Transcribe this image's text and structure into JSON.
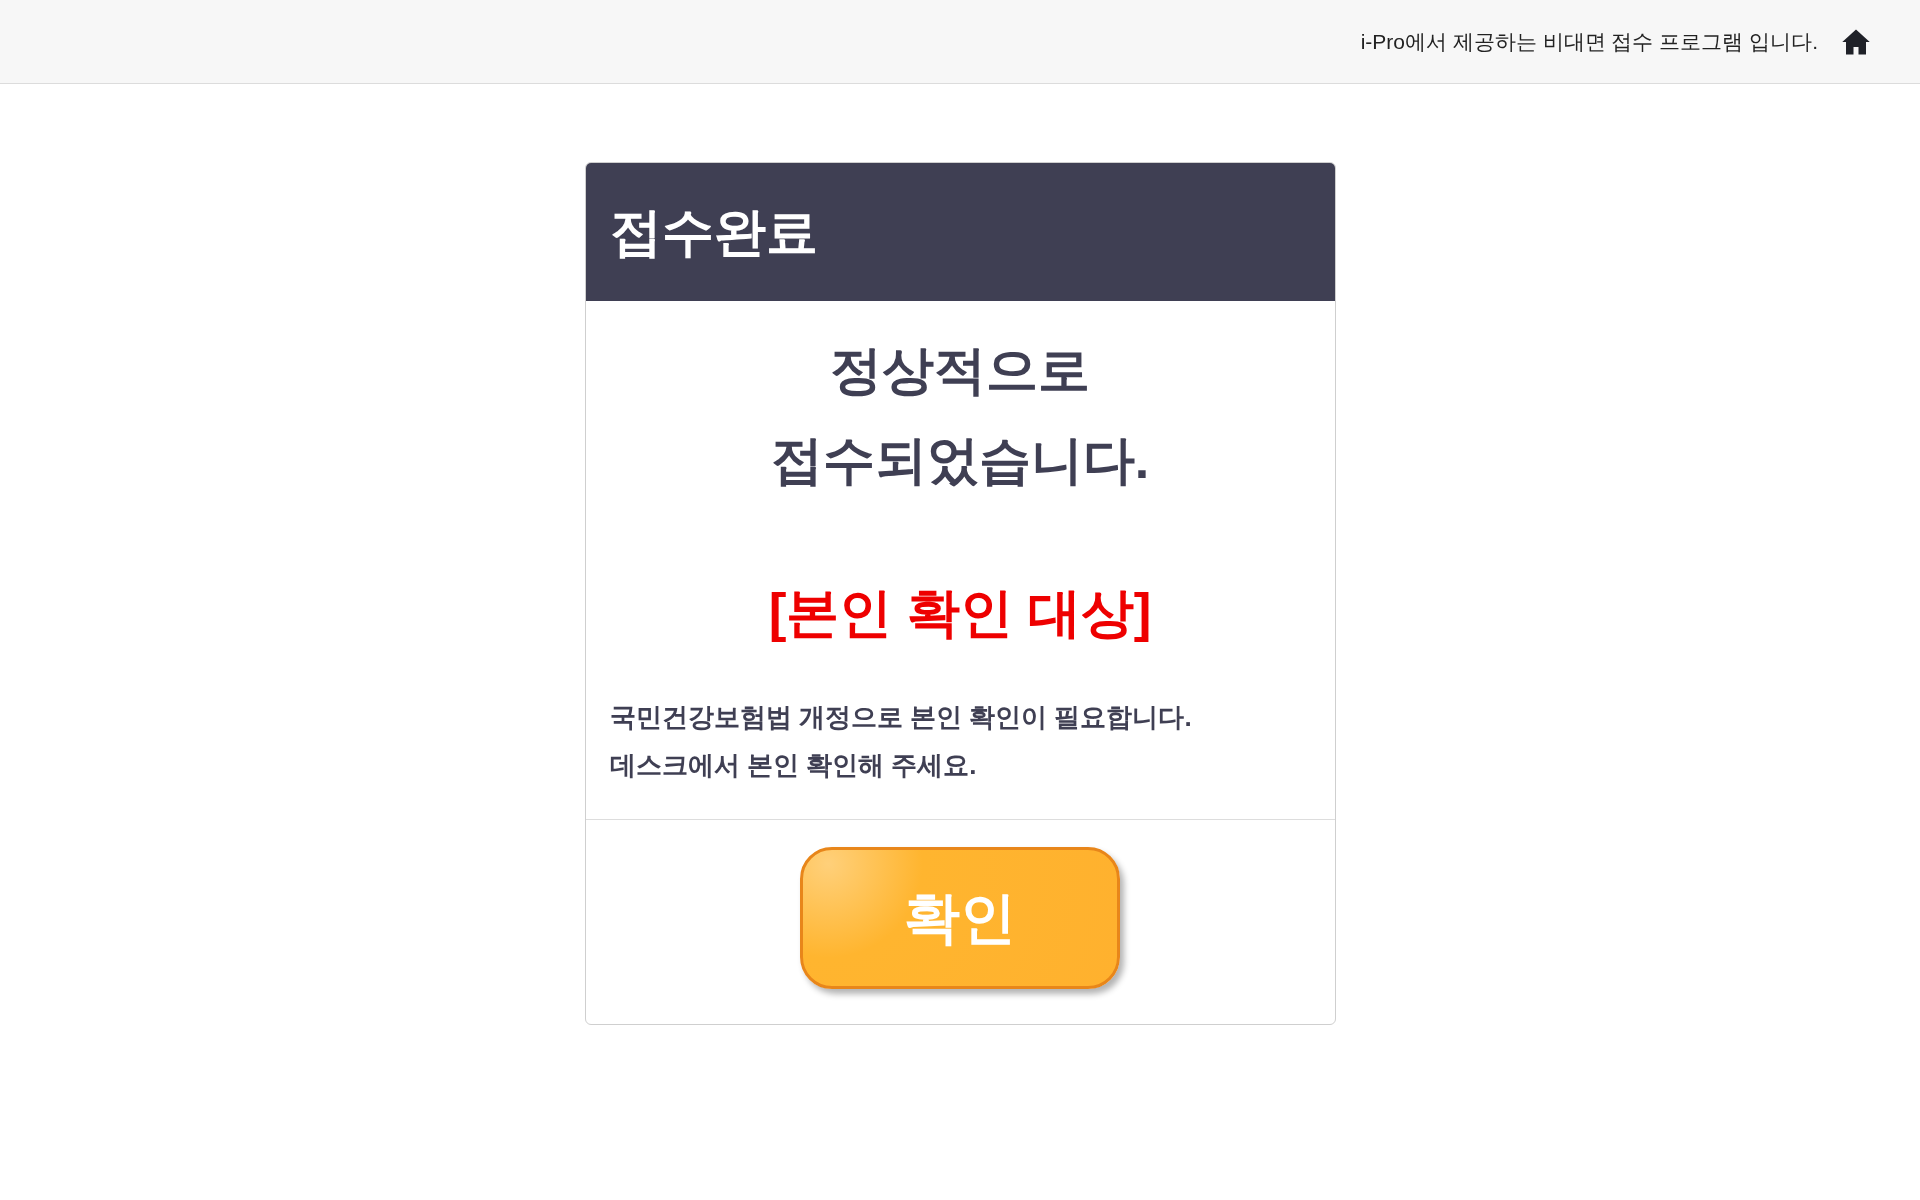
{
  "header": {
    "notice": "i-Pro에서 제공하는 비대면 접수 프로그램 입니다."
  },
  "card": {
    "title": "접수완료",
    "message_lines": [
      "정상적으로",
      "접수되었습니다."
    ],
    "alert": "[본인 확인 대상]",
    "description_lines": [
      "국민건강보험법 개정으로 본인 확인이 필요합니다.",
      "데스크에서 본인 확인해 주세요."
    ],
    "confirm_button": "확인"
  }
}
